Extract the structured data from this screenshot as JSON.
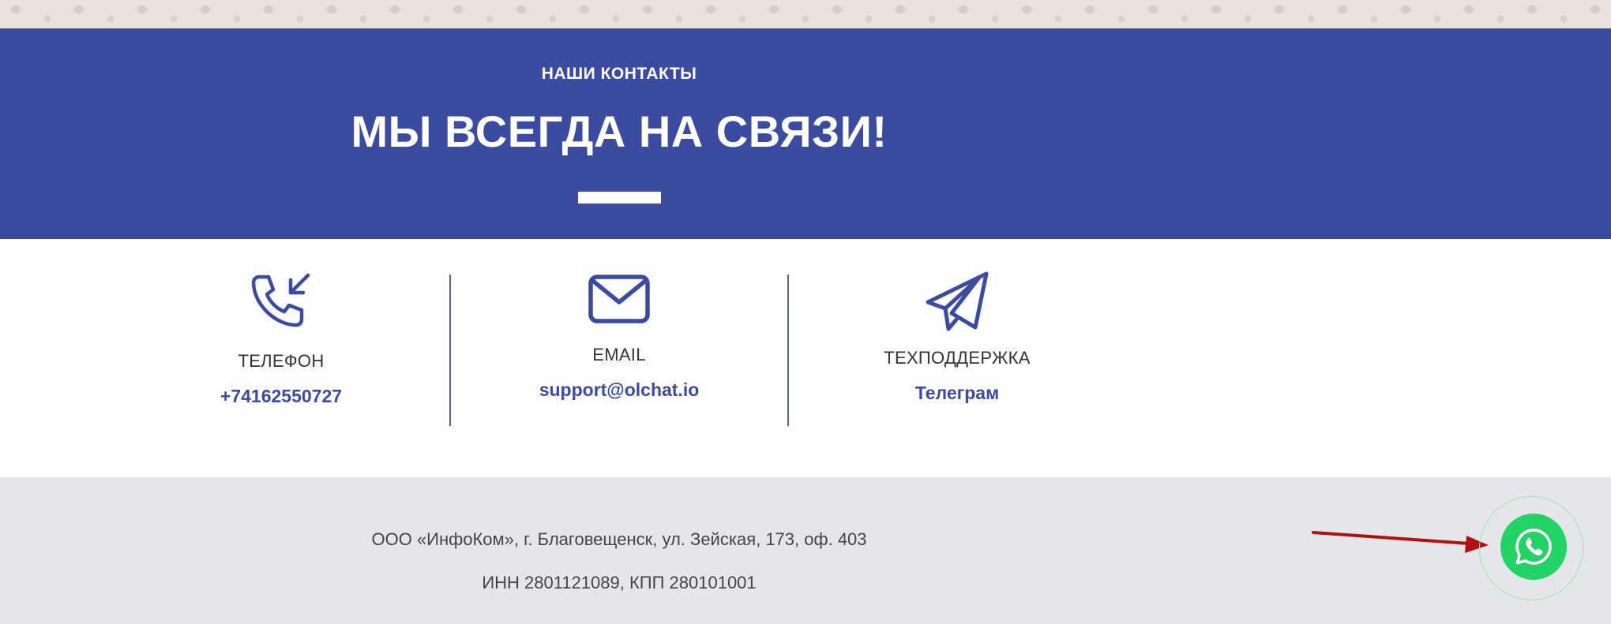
{
  "hero": {
    "kicker": "НАШИ КОНТАКТЫ",
    "title": "МЫ ВСЕГДА НА СВЯЗИ!"
  },
  "contacts": [
    {
      "icon": "phone-incoming-icon",
      "label": "ТЕЛЕФОН",
      "value": "+74162550727"
    },
    {
      "icon": "envelope-icon",
      "label": "EMAIL",
      "value": "support@olchat.io"
    },
    {
      "icon": "paper-plane-icon",
      "label": "ТЕХПОДДЕРЖКА",
      "value": "Телеграм"
    }
  ],
  "footer": {
    "company": "ООО «ИнфоКом», г. Благовещенск, ул. Зейская, 173, оф. 403",
    "requisites": "ИНН 2801121089, КПП 280101001"
  },
  "floating_button": {
    "icon": "whatsapp-icon"
  },
  "colors": {
    "brand": "#3a4ba0",
    "whatsapp": "#24d366",
    "arrow": "#b30f12",
    "footer_bg": "#e5e6ea"
  }
}
